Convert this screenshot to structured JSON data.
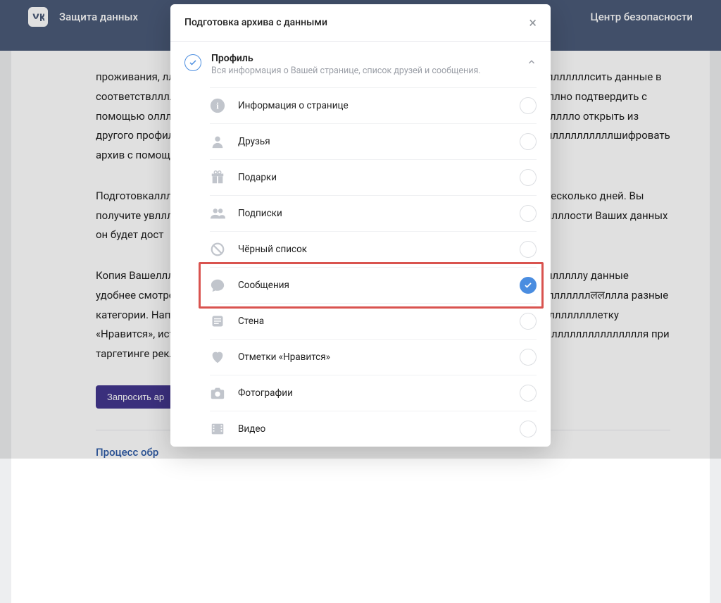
{
  "header": {
    "brand": "VK",
    "title": "Защита данных",
    "right": "Центр безопасности"
  },
  "page": {
    "p1": "проживания, ллллллллллллллллллллллллллллллллллллллллллллллллллллллллллллллллллллллсить данные в соответствлллллллллллллллллллллллллллллллллллллллллллллллллллллллллллллллллллно подтвердить с помощью оллллллллललललललललललललललллलललллллллллллллллллллллллллллллллллллллллло открыть из другого профиля. Влллллллллллллллллллллллллллллллллллллллллллллллллллллллллллллллллллллшифровать архив с помощью п",
    "p2": "Подготовкаллллллллллллллллллллллллллллллллллллллллллллллллллллллллллллллллнесколько дней. Вы получите увллллллллллллллллллллллллллллллллллллллллллллллллллллллллллллллллллллости Ваших данных он будет дост",
    "p3": "Копия Вашеллллллллллллллллллллллллллллллллллллллллллллллллллллллллллллллллллллллу данные удобнее смотреть наллллллллллллллллллллллллллллллллллллллллллллллллллллллллллллллллललллла разные категории. Например, ллллллллллллллллллллллллллллллллллллллллллллллллллллллллллллллллетку «Нравится», историю делллллллллллллллллллллллллллллллллллллллллллллллллллллллллллллллллллллля при таргетинге рекламных",
    "request_btn": "Запросить ар",
    "process_link": "Процесс обр"
  },
  "modal": {
    "title": "Подготовка архива с данными",
    "section_title": "Профиль",
    "section_sub": "Вся информация о Вашей странице, список друзей и сообщения.",
    "items": [
      {
        "label": "Информация о странице",
        "icon": "info",
        "checked": false,
        "highlight": false
      },
      {
        "label": "Друзья",
        "icon": "person",
        "checked": false,
        "highlight": false
      },
      {
        "label": "Подарки",
        "icon": "gift",
        "checked": false,
        "highlight": false
      },
      {
        "label": "Подписки",
        "icon": "people",
        "checked": false,
        "highlight": false
      },
      {
        "label": "Чёрный список",
        "icon": "block",
        "checked": false,
        "highlight": false
      },
      {
        "label": "Сообщения",
        "icon": "chat",
        "checked": true,
        "highlight": true
      },
      {
        "label": "Стена",
        "icon": "wall",
        "checked": false,
        "highlight": false
      },
      {
        "label": "Отметки «Нравится»",
        "icon": "heart",
        "checked": false,
        "highlight": false
      },
      {
        "label": "Фотографии",
        "icon": "camera",
        "checked": false,
        "highlight": false
      },
      {
        "label": "Видео",
        "icon": "film",
        "checked": false,
        "highlight": false
      }
    ]
  },
  "icons": {
    "info": "i",
    "person": "👤",
    "gift": "🎁",
    "people": "👥",
    "block": "🚫",
    "chat": "💬",
    "wall": "▤",
    "heart": "♥",
    "camera": "📷",
    "film": "🎞"
  }
}
